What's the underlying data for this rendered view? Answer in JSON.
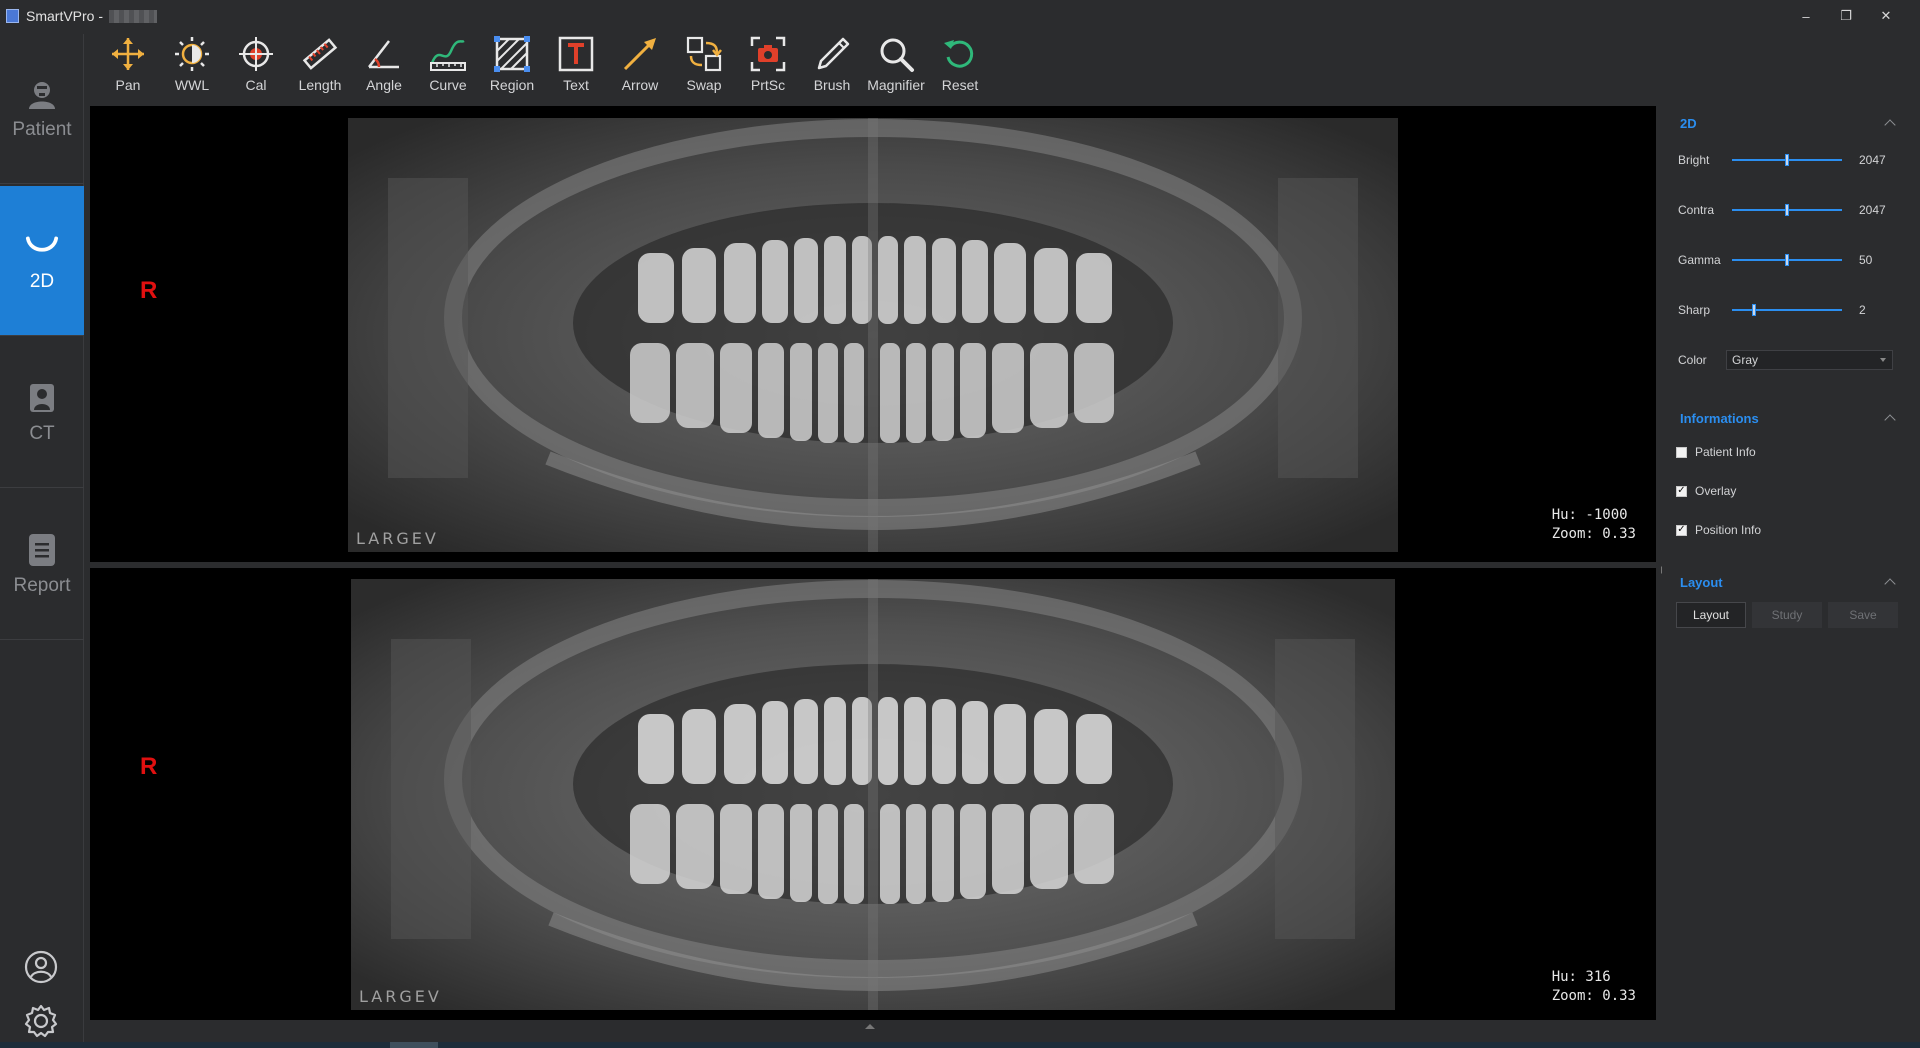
{
  "window": {
    "app_title": "SmartVPro -",
    "min_glyph": "–",
    "restore_glyph": "❐",
    "close_glyph": "✕"
  },
  "sidebar": {
    "items": [
      {
        "label": "Patient",
        "icon": "patient-icon"
      },
      {
        "label": "2D",
        "icon": "dental-arch-icon",
        "active": true
      },
      {
        "label": "CT",
        "icon": "ct-scanner-icon"
      },
      {
        "label": "Report",
        "icon": "report-icon"
      }
    ],
    "bottom_icons": [
      "user-icon",
      "gear-icon"
    ]
  },
  "toolbar": {
    "tools": [
      {
        "label": "Pan",
        "icon": "pan-icon"
      },
      {
        "label": "WWL",
        "icon": "wwl-icon"
      },
      {
        "label": "Cal",
        "icon": "calibrate-icon"
      },
      {
        "label": "Length",
        "icon": "ruler-icon"
      },
      {
        "label": "Angle",
        "icon": "angle-icon"
      },
      {
        "label": "Curve",
        "icon": "curve-icon"
      },
      {
        "label": "Region",
        "icon": "region-icon"
      },
      {
        "label": "Text",
        "icon": "text-icon"
      },
      {
        "label": "Arrow",
        "icon": "arrow-icon"
      },
      {
        "label": "Swap",
        "icon": "swap-icon"
      },
      {
        "label": "PrtSc",
        "icon": "camera-icon"
      },
      {
        "label": "Brush",
        "icon": "brush-icon"
      },
      {
        "label": "Magnifier",
        "icon": "magnifier-icon"
      },
      {
        "label": "Reset",
        "icon": "reset-icon"
      }
    ]
  },
  "viewports": [
    {
      "side_marker": "R",
      "hu": "Hu: -1000",
      "zoom": "Zoom: 0.33",
      "brand": "LARGEV"
    },
    {
      "side_marker": "R",
      "hu": "Hu: 316",
      "zoom": "Zoom: 0.33",
      "brand": "LARGEV"
    }
  ],
  "panel": {
    "section_2d": {
      "title": "2D",
      "sliders": [
        {
          "label": "Bright",
          "value": "2047",
          "level": 0.5
        },
        {
          "label": "Contra",
          "value": "2047",
          "level": 0.5
        },
        {
          "label": "Gamma",
          "value": "50",
          "level": 0.5
        },
        {
          "label": "Sharp",
          "value": "2",
          "level": 0.2
        }
      ],
      "color_label": "Color",
      "color_value": "Gray"
    },
    "section_info": {
      "title": "Informations",
      "checkboxes": [
        {
          "label": "Patient Info",
          "checked": false
        },
        {
          "label": "Overlay",
          "checked": true
        },
        {
          "label": "Position Info",
          "checked": true
        }
      ]
    },
    "section_layout": {
      "title": "Layout",
      "buttons": [
        {
          "label": "Layout",
          "enabled": true
        },
        {
          "label": "Study",
          "enabled": false
        },
        {
          "label": "Save",
          "enabled": false
        }
      ]
    }
  },
  "colors": {
    "accent": "#1e7fd6",
    "link": "#2b8ef0",
    "marker": "#e01010",
    "background": "#2b2c2e"
  }
}
